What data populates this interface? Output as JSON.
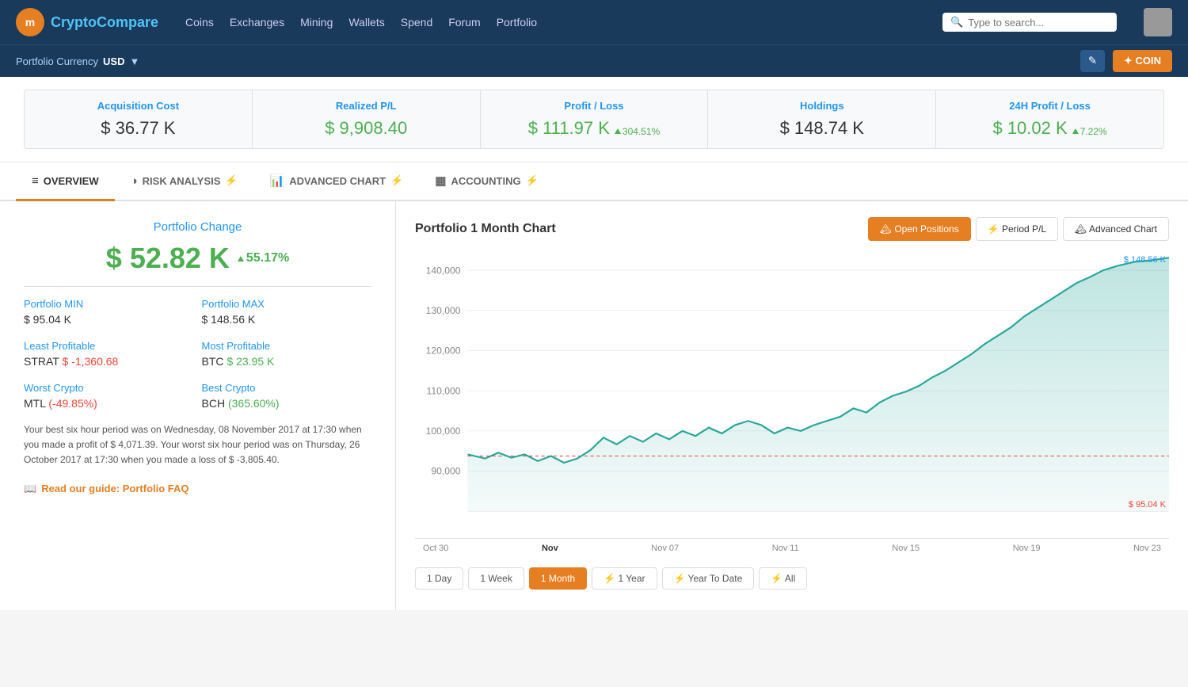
{
  "nav": {
    "logo_crypto": "Crypto",
    "logo_compare": "Compare",
    "logo_icon": "m",
    "links": [
      "Coins",
      "Exchanges",
      "Mining",
      "Wallets",
      "Spend",
      "Forum",
      "Portfolio"
    ],
    "search_placeholder": "Type to search..."
  },
  "subnav": {
    "portfolio_currency_label": "Portfolio Currency",
    "portfolio_currency_value": "USD",
    "add_coin_label": "✦ COIN"
  },
  "summary": {
    "cards": [
      {
        "label": "Acquisition Cost",
        "value": "$ 36.77 K",
        "green": false,
        "badge": null
      },
      {
        "label": "Realized P/L",
        "value": "$ 9,908.40",
        "green": true,
        "badge": null
      },
      {
        "label": "Profit / Loss",
        "value": "$ 111.97 K",
        "green": true,
        "badge": "304.51%"
      },
      {
        "label": "Holdings",
        "value": "$ 148.74 K",
        "green": false,
        "badge": null
      },
      {
        "label": "24H Profit / Loss",
        "value": "$ 10.02 K",
        "green": true,
        "badge": "7.22%"
      }
    ]
  },
  "tabs": [
    {
      "id": "overview",
      "icon": "≡",
      "label": "OVERVIEW",
      "active": true,
      "lightning": false
    },
    {
      "id": "risk",
      "icon": "◑",
      "label": "RISK ANALYSIS",
      "active": false,
      "lightning": true
    },
    {
      "id": "advanced-chart",
      "icon": "📊",
      "label": "ADVANCED CHART",
      "active": false,
      "lightning": true
    },
    {
      "id": "accounting",
      "icon": "▦",
      "label": "ACCOUNTING",
      "active": false,
      "lightning": true
    }
  ],
  "left_panel": {
    "portfolio_change_title": "Portfolio Change",
    "portfolio_change_value": "$ 52.82 K",
    "portfolio_change_pct": "55.17%",
    "stats": [
      {
        "label": "Portfolio MIN",
        "value": "$ 95.04 K",
        "type": "neutral",
        "col": "left"
      },
      {
        "label": "Portfolio MAX",
        "value": "$ 148.56 K",
        "type": "neutral",
        "col": "right"
      },
      {
        "label": "Least Profitable",
        "value_prefix": "STRAT ",
        "value_colored": "$ -1,360.68",
        "type": "neg",
        "col": "left"
      },
      {
        "label": "Most Profitable",
        "value_prefix": "BTC ",
        "value_colored": "$ 23.95 K",
        "type": "pos",
        "col": "right"
      },
      {
        "label": "Worst Crypto",
        "value_prefix": "MTL ",
        "value_colored": "(-49.85%)",
        "type": "neg",
        "col": "left"
      },
      {
        "label": "Best Crypto",
        "value_prefix": "BCH ",
        "value_colored": "(365.60%)",
        "type": "pos",
        "col": "right"
      }
    ],
    "info_text": "Your best six hour period was on Wednesday, 08 November 2017 at 17:30 when you made a profit of $ 4,071.39. Your worst six hour period was on Thursday, 26 October 2017 at 17:30 when you made a loss of $ -3,805.40.",
    "guide_label": "Read our guide: Portfolio FAQ"
  },
  "right_panel": {
    "chart_title": "Portfolio 1 Month Chart",
    "buttons": [
      {
        "label": "Open Positions",
        "icon": "🏔",
        "active": true,
        "id": "open-positions"
      },
      {
        "label": "Period P/L",
        "icon": "⚡",
        "active": false,
        "id": "period-pl"
      },
      {
        "label": "Advanced Chart",
        "icon": "🏔",
        "active": false,
        "id": "advanced-chart"
      }
    ],
    "y_labels": [
      "140,000",
      "130,000",
      "120,000",
      "110,000",
      "100,000",
      "90,000"
    ],
    "x_labels": [
      "Oct 30",
      "Nov",
      "Nov 07",
      "Nov 11",
      "Nov 15",
      "Nov 19",
      "Nov 23"
    ],
    "chart_max_label": "$ 148.56 K",
    "chart_min_label": "$ 95.04 K",
    "time_buttons": [
      {
        "label": "1 Day",
        "active": false,
        "lightning": false
      },
      {
        "label": "1 Week",
        "active": false,
        "lightning": false
      },
      {
        "label": "1 Month",
        "active": true,
        "lightning": false
      },
      {
        "label": "1 Year",
        "active": false,
        "lightning": true
      },
      {
        "label": "Year To Date",
        "active": false,
        "lightning": true
      },
      {
        "label": "All",
        "active": false,
        "lightning": true
      }
    ]
  }
}
